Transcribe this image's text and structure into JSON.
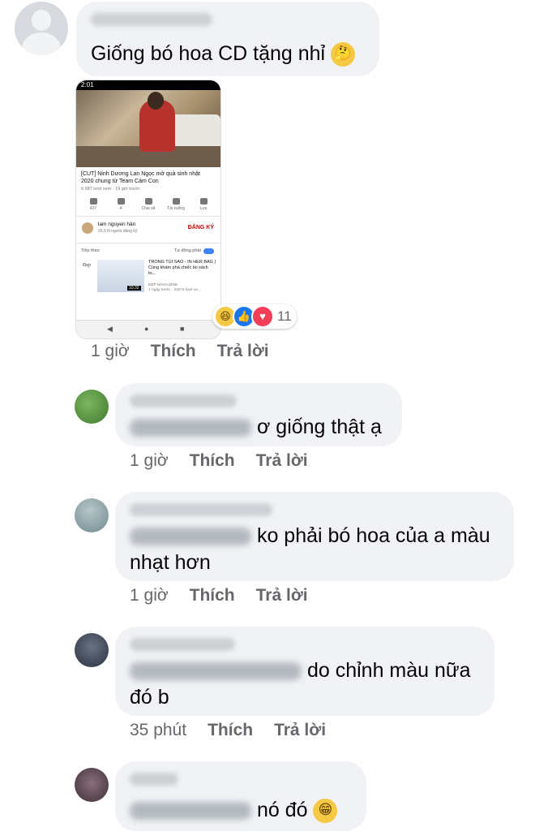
{
  "comments": [
    {
      "text": "Giống bó hoa CD tặng nhỉ",
      "emoji": "thinking-face",
      "screenshot": {
        "status_time": "2:01",
        "video_title": "[CUT] Ninh Dương Lan Ngọc mở quà sinh nhật 2020 chung từ Team Cám Con",
        "video_meta": "6.687 lượt xem · 19 giờ trước",
        "actions": [
          "427",
          "4",
          "Chia sẻ",
          "Tải xuống",
          "Lưu"
        ],
        "channel_name": "lam nguyen hân",
        "channel_subs": "25,5 N người đăng ký",
        "subscribe_label": "ĐĂNG KÝ",
        "up_next_label": "Tiếp theo",
        "autoplay_label": "Tự động phát",
        "rec_logo": "Đẹp",
        "rec_duration": "10:32",
        "rec_title": "TRONG TÚI SAO - IN HER BAG | Cùng khám phá chiếc túi xách to...",
        "rec_channel": "ĐẸP MAGAZINE",
        "rec_meta": "1 ngày trước · 226 N lượt xe..."
      },
      "reactions": {
        "count": "11",
        "types": [
          "haha",
          "like",
          "love"
        ]
      },
      "time": "1 giờ",
      "like_label": "Thích",
      "reply_label": "Trả lời"
    },
    {
      "text": "ơ giống thật ạ",
      "time": "1 giờ",
      "like_label": "Thích",
      "reply_label": "Trả lời"
    },
    {
      "text_line1": "ko phải bó hoa của a màu",
      "text_line2": "nhạt hơn",
      "time": "1 giờ",
      "like_label": "Thích",
      "reply_label": "Trả lời"
    },
    {
      "text_line1": "do chỉnh màu nữa",
      "text_line2": "đó b",
      "time": "35 phút",
      "like_label": "Thích",
      "reply_label": "Trả lời"
    },
    {
      "text": "nó đó",
      "emoji": "grinning-face",
      "time": "",
      "like_label": "",
      "reply_label": ""
    }
  ],
  "colors": {
    "bubble": "#f0f2f5",
    "meta_text": "#65676b",
    "like_blue": "#1877f2",
    "love_red": "#f33e58",
    "haha_yellow": "#f6c944"
  }
}
